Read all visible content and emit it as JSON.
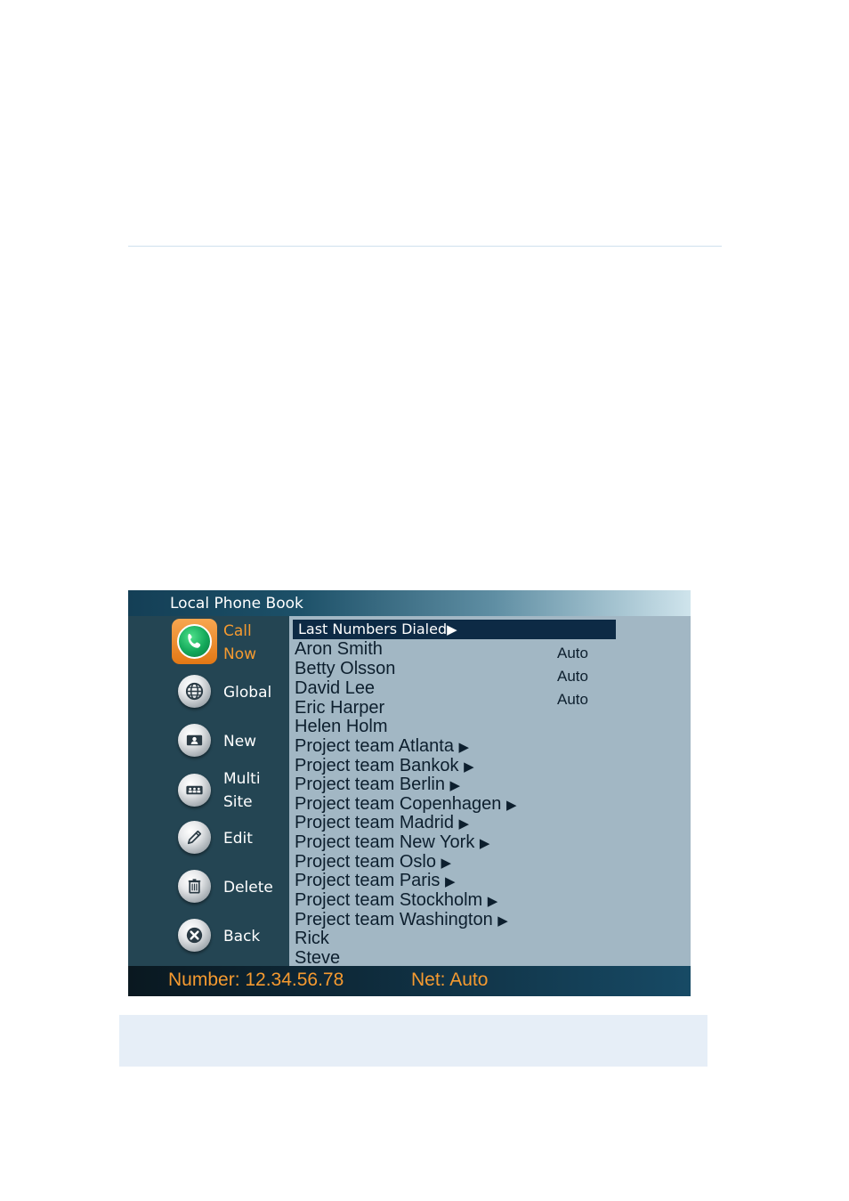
{
  "window": {
    "title": "Local Phone Book"
  },
  "sidebar": {
    "call": {
      "line1": "Call",
      "line2": "Now"
    },
    "global": {
      "label": "Global"
    },
    "new": {
      "label": "New"
    },
    "multisite": {
      "line1": "Multi",
      "line2": "Site"
    },
    "edit": {
      "label": "Edit"
    },
    "delete": {
      "label": "Delete"
    },
    "back": {
      "label": "Back"
    }
  },
  "list": {
    "header": "Last Numbers Dialed",
    "entries": [
      "Aron Smith",
      "Betty Olsson",
      "David Lee",
      "Eric Harper",
      "Helen Holm",
      "Project team Atlanta",
      "Project team Bankok",
      "Project team Berlin",
      "Project team Copenhagen",
      "Project team Madrid",
      "Project team New York",
      "Project team Oslo",
      "Project team Paris",
      "Project team Stockholm",
      "Preject team Washington",
      "Rick",
      "Steve"
    ],
    "net_values": [
      "Auto",
      "Auto",
      "Auto"
    ]
  },
  "status": {
    "number": "Number: 12.34.56.78",
    "net": "Net: Auto"
  },
  "colors": {
    "accent_orange": "#f59a30",
    "sidebar_bg": "#244553",
    "list_bg": "#a2b7c4",
    "header_bg": "#0d2a45"
  }
}
